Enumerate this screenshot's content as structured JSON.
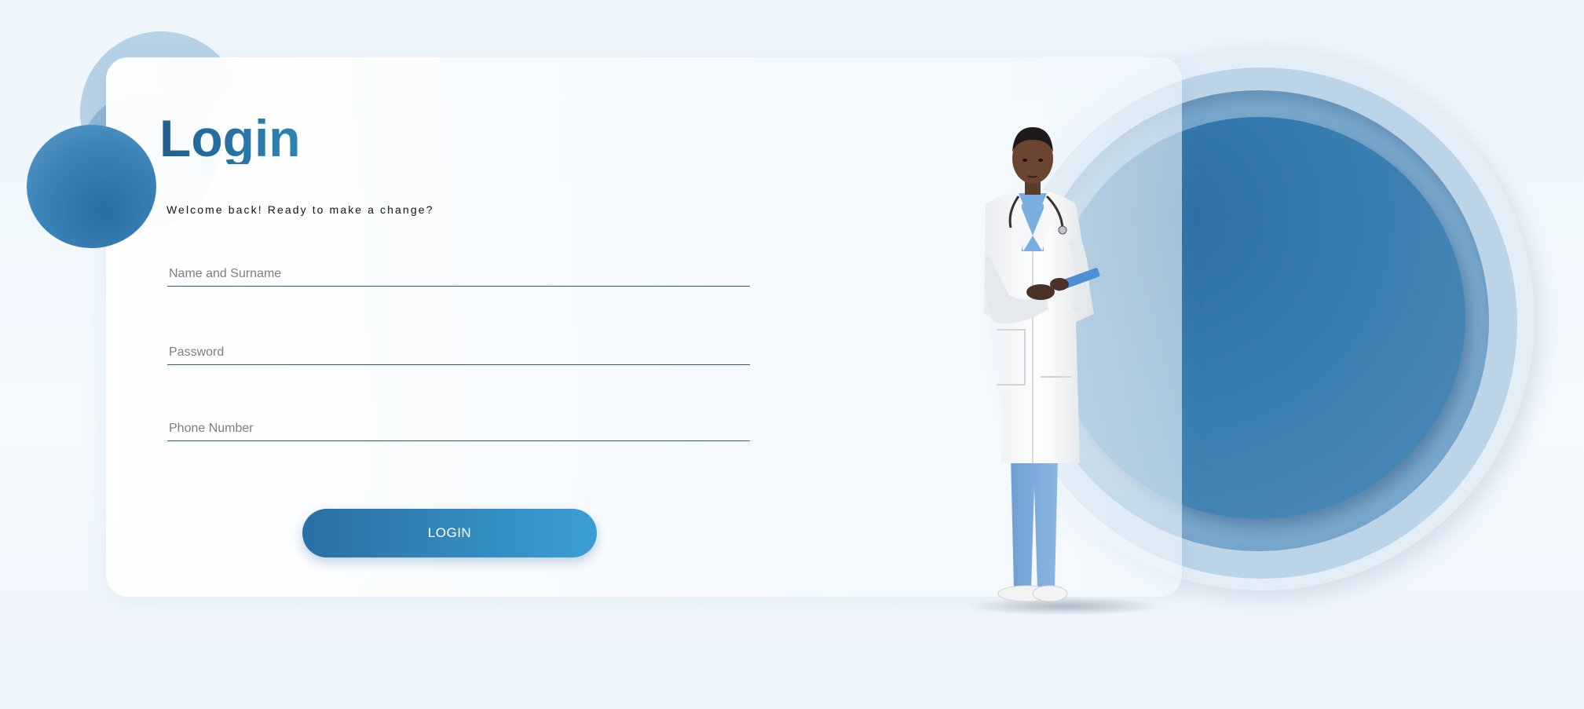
{
  "page": {
    "title": "Login",
    "subtitle": "Welcome back! Ready to make a change?"
  },
  "form": {
    "name_field": {
      "placeholder": "Name and Surname",
      "value": ""
    },
    "password_field": {
      "placeholder": "Password",
      "value": ""
    },
    "phone_field": {
      "placeholder": "Phone Number",
      "value": ""
    },
    "login_label": "LOGIN"
  },
  "colors": {
    "accent": "#2b6fa3",
    "accent_light": "#3a9fd4",
    "title": "#1e5f8f",
    "field_line": "#2f5f72"
  },
  "illustration": {
    "icon": "doctor-illustration-icon"
  }
}
